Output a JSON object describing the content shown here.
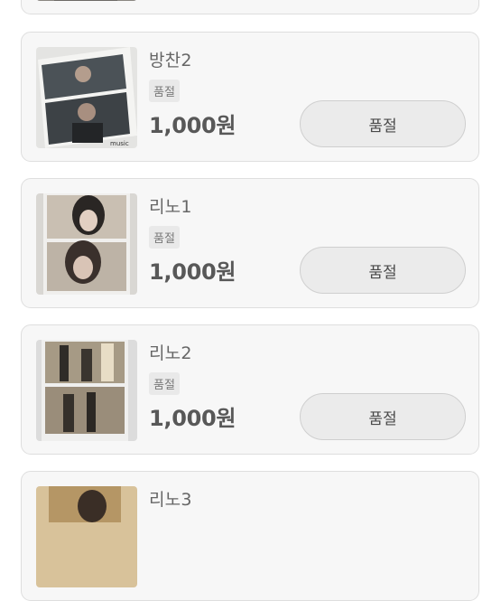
{
  "listing": {
    "items": [
      {
        "name": "",
        "status": "",
        "price": "",
        "button": ""
      },
      {
        "name": "방찬2",
        "status": "품절",
        "price": "1,000원",
        "button": "품절"
      },
      {
        "name": "리노1",
        "status": "품절",
        "price": "1,000원",
        "button": "품절"
      },
      {
        "name": "리노2",
        "status": "품절",
        "price": "1,000원",
        "button": "품절"
      },
      {
        "name": "리노3",
        "status": "",
        "price": "",
        "button": ""
      }
    ]
  }
}
